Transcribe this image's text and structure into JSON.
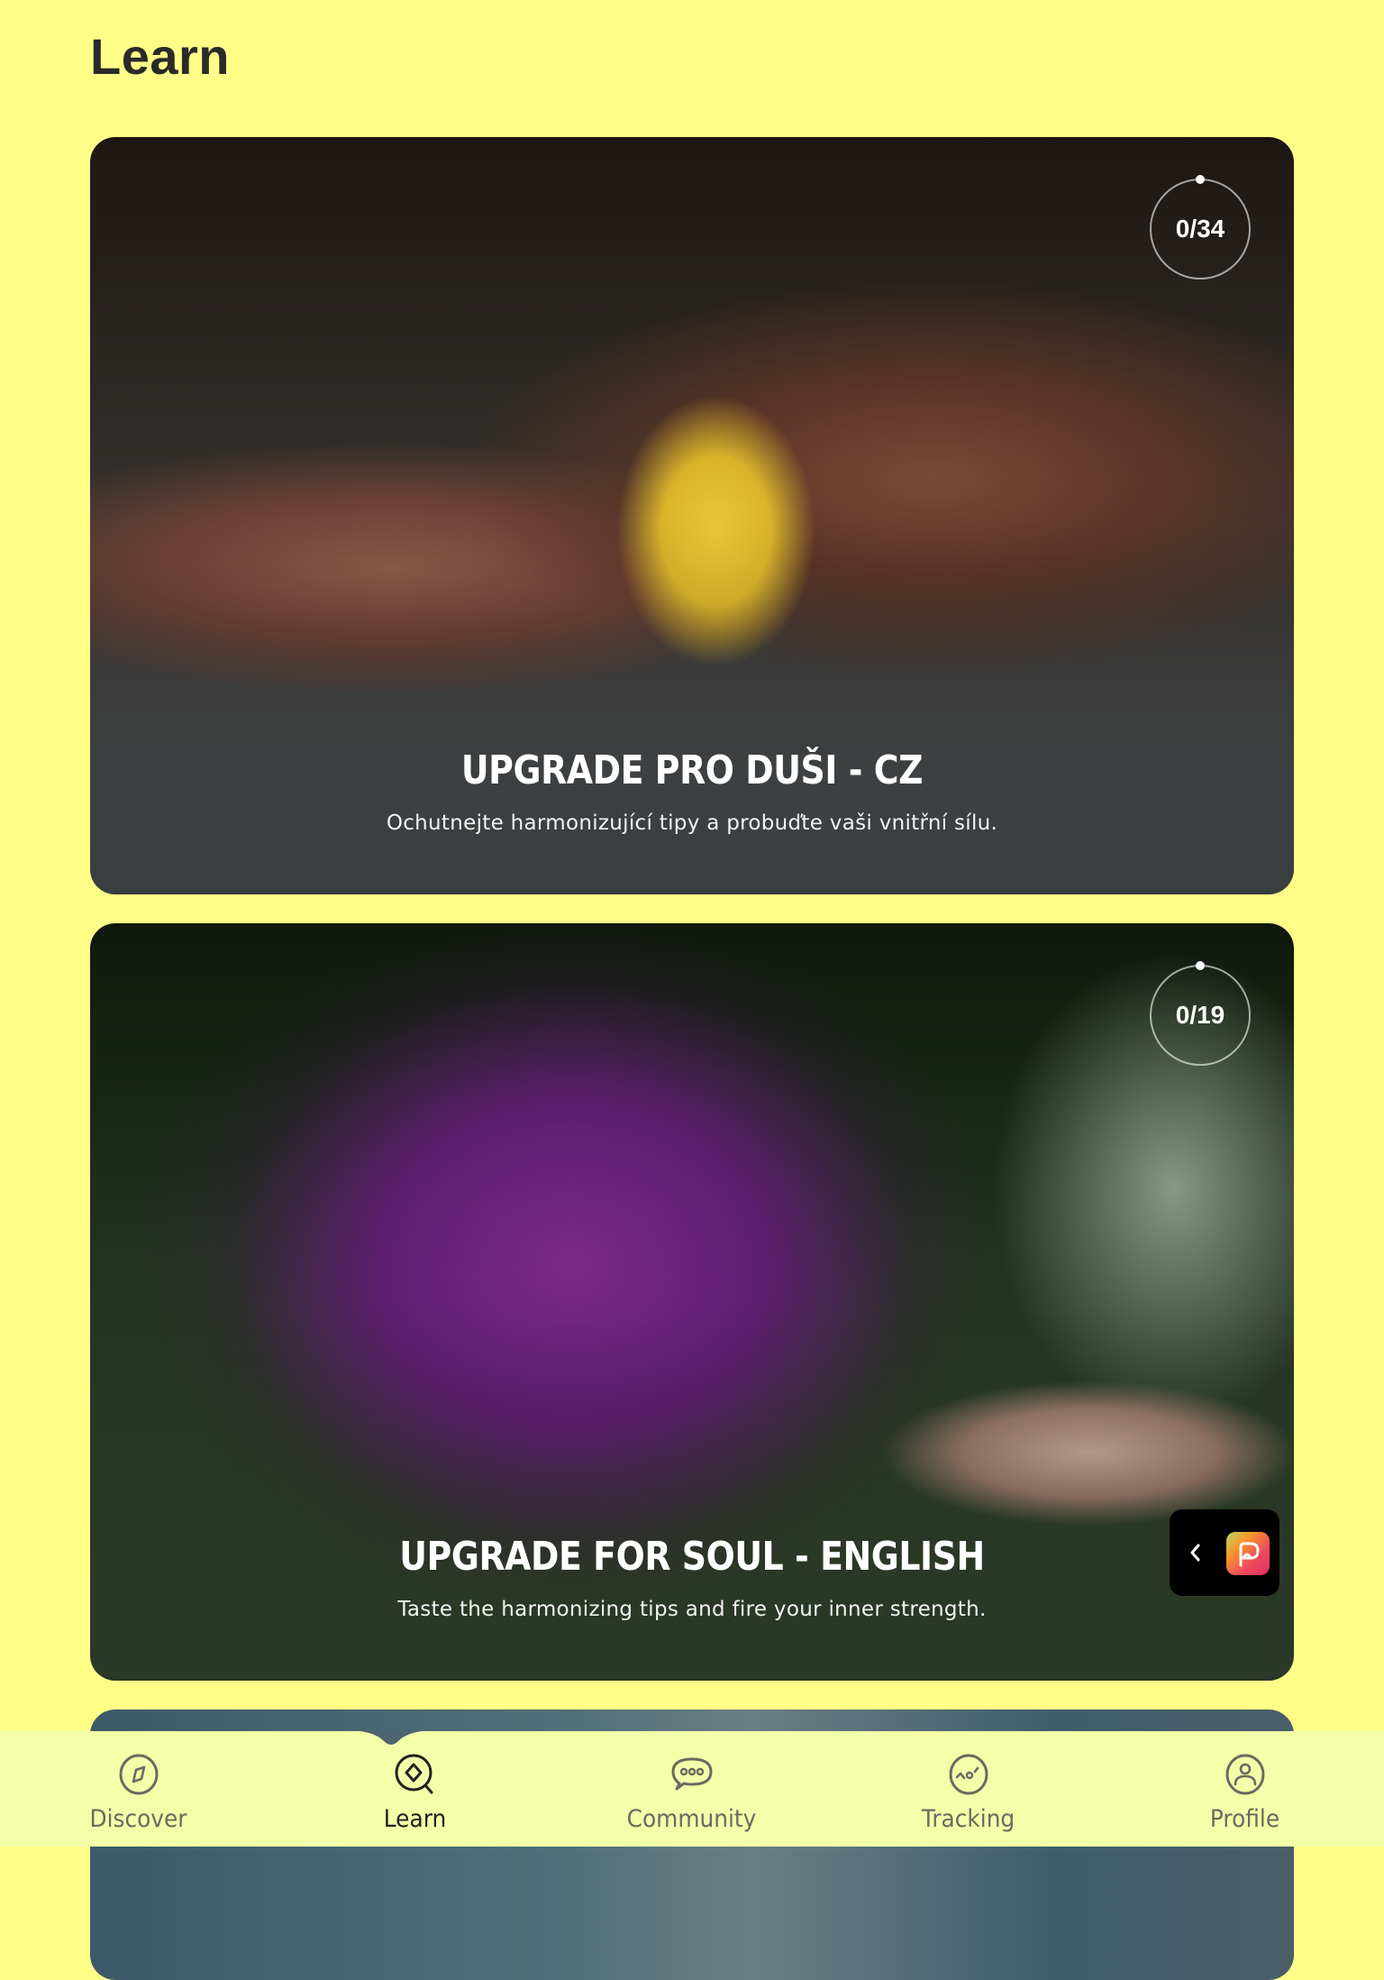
{
  "page": {
    "title": "Learn"
  },
  "courses": [
    {
      "title": "UPGRADE PRO DUŠI - CZ",
      "subtitle": "Ochutnejte harmonizující tipy a probuďte vaši vnitřní sílu.",
      "progress_text": "0/34",
      "progress": {
        "completed": 0,
        "total": 34
      },
      "image_description": "hands-holding-yellow-flower"
    },
    {
      "title": "UPGRADE FOR SOUL - ENGLISH",
      "subtitle": "Taste the harmonizing tips and fire your inner strength.",
      "progress_text": "0/19",
      "progress": {
        "completed": 0,
        "total": 19
      },
      "image_description": "hand-holding-purple-hydrangea"
    },
    {
      "image_description": "partially-visible-blue-card"
    }
  ],
  "floating_widget": {
    "back_icon": "chevron-left-icon",
    "app_icon": "app-logo-icon"
  },
  "nav": {
    "active": "Learn",
    "items": [
      {
        "label": "Discover",
        "icon": "compass-icon"
      },
      {
        "label": "Learn",
        "icon": "learn-search-icon"
      },
      {
        "label": "Community",
        "icon": "chat-bubble-icon"
      },
      {
        "label": "Tracking",
        "icon": "tracking-chart-icon"
      },
      {
        "label": "Profile",
        "icon": "profile-icon"
      }
    ]
  },
  "colors": {
    "background": "#ffff88",
    "nav_background": "#f3ffa8",
    "text_dark": "#2a2a2a",
    "nav_inactive": "#6a6a62"
  }
}
